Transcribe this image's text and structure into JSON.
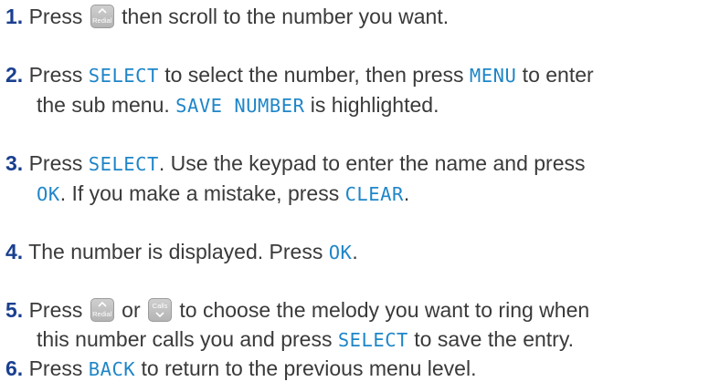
{
  "keys": {
    "redial": "Redial",
    "calls": "Calls"
  },
  "steps": [
    {
      "num": "1",
      "dot": ".",
      "t1": "Press",
      "t2": "then scroll to the number you want."
    },
    {
      "num": "2",
      "dot": ".",
      "t1": "Press ",
      "k1": "SELECT",
      "t2": " to select the number, then press ",
      "k2": "MENU",
      "t3": " to enter",
      "l2a": "the sub menu. ",
      "k3": "SAVE NUMBER",
      "l2b": " is highlighted."
    },
    {
      "num": "3",
      "dot": ".",
      "t1": "Press ",
      "k1": "SELECT",
      "t2": ". Use the keypad to enter the name and press",
      "k2": "OK",
      "l2a": ". If you make a mistake, press ",
      "k3": "CLEAR",
      "l2b": "."
    },
    {
      "num": "4",
      "dot": ".",
      "t1": "The number is displayed. Press ",
      "k1": "OK",
      "t2": "."
    },
    {
      "num": "5",
      "dot": ".",
      "t1": "Press",
      "t2": "or",
      "t3": "to choose the melody you want to ring when",
      "l2a": "this number calls you and press ",
      "k1": "SELECT",
      "l2b": " to save the entry."
    },
    {
      "num": "6",
      "dot": ".",
      "t1": "Press ",
      "k1": "BACK",
      "t2": " to return to the previous menu level."
    }
  ]
}
